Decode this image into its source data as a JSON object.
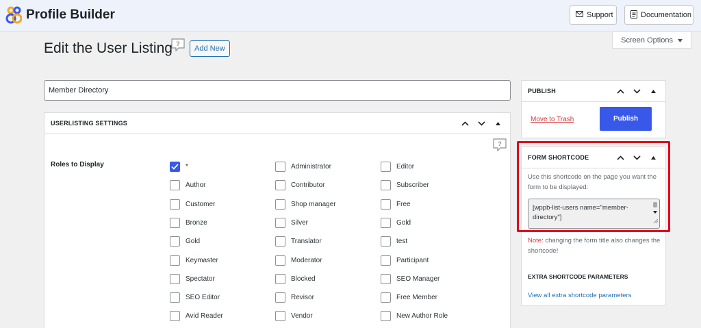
{
  "app": {
    "name": "Profile Builder"
  },
  "header": {
    "support_label": "Support",
    "documentation_label": "Documentation",
    "screen_options_label": "Screen Options"
  },
  "page": {
    "title": "Edit the User Listing",
    "add_new_label": "Add New",
    "title_value": "Member Directory"
  },
  "settings": {
    "heading": "USERLISTING SETTINGS",
    "roles_label": "Roles to Display",
    "roles": [
      {
        "label": "*",
        "checked": true
      },
      {
        "label": "Administrator",
        "checked": false
      },
      {
        "label": "Editor",
        "checked": false
      },
      {
        "label": "Author",
        "checked": false
      },
      {
        "label": "Contributor",
        "checked": false
      },
      {
        "label": "Subscriber",
        "checked": false
      },
      {
        "label": "Customer",
        "checked": false
      },
      {
        "label": "Shop manager",
        "checked": false
      },
      {
        "label": "Free",
        "checked": false
      },
      {
        "label": "Bronze",
        "checked": false
      },
      {
        "label": "Silver",
        "checked": false
      },
      {
        "label": "Gold",
        "checked": false
      },
      {
        "label": "Gold",
        "checked": false
      },
      {
        "label": "Translator",
        "checked": false
      },
      {
        "label": "test",
        "checked": false
      },
      {
        "label": "Keymaster",
        "checked": false
      },
      {
        "label": "Moderator",
        "checked": false
      },
      {
        "label": "Participant",
        "checked": false
      },
      {
        "label": "Spectator",
        "checked": false
      },
      {
        "label": "Blocked",
        "checked": false
      },
      {
        "label": "SEO Manager",
        "checked": false
      },
      {
        "label": "SEO Editor",
        "checked": false
      },
      {
        "label": "Revisor",
        "checked": false
      },
      {
        "label": "Free Member",
        "checked": false
      },
      {
        "label": "Avid Reader",
        "checked": false
      },
      {
        "label": "Vendor",
        "checked": false
      },
      {
        "label": "New Author Role",
        "checked": false
      }
    ]
  },
  "publish": {
    "heading": "PUBLISH",
    "move_to_trash_label": "Move to Trash",
    "publish_label": "Publish"
  },
  "shortcode": {
    "heading": "FORM SHORTCODE",
    "description": "Use this shortcode on the page you want the form to be displayed:",
    "value": "[wppb-list-users name=\"member-directory\"]",
    "note_prefix": "Note:",
    "note_text": " changing the form title also changes the shortcode!",
    "extra_heading": "EXTRA SHORTCODE PARAMETERS",
    "extra_link": "View all extra shortcode parameters"
  },
  "colors": {
    "accent": "#3858e9",
    "link": "#2271b1",
    "danger": "#d63638",
    "highlight": "#e0001b"
  }
}
